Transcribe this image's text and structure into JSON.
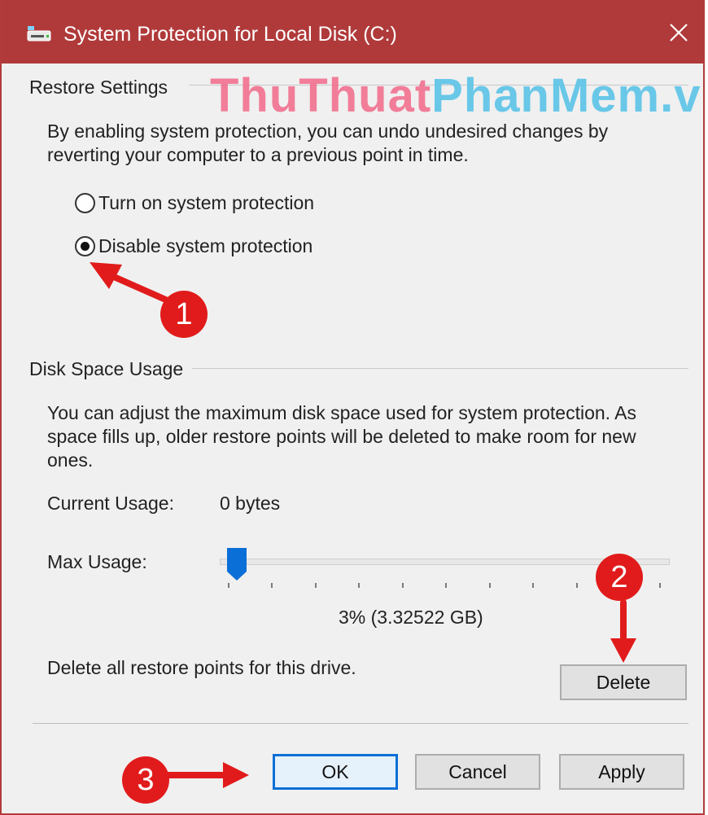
{
  "window": {
    "title": "System Protection for Local Disk (C:)"
  },
  "watermark": {
    "part1": "ThuThuat",
    "part2": "PhanMem.vn"
  },
  "restore_settings": {
    "group_label": "Restore Settings",
    "description_line1": "By enabling system protection, you can undo undesired changes by",
    "description_line2": "reverting your computer to a previous point in time.",
    "options": [
      {
        "label": "Turn on system protection",
        "selected": false
      },
      {
        "label": "Disable system protection",
        "selected": true
      }
    ]
  },
  "disk_space": {
    "group_label": "Disk Space Usage",
    "description_line1": "You can adjust the maximum disk space used for system protection. As",
    "description_line2": "space fills up, older restore points will be deleted to make room for new",
    "description_line3": "ones.",
    "current_usage_label": "Current Usage:",
    "current_usage_value": "0 bytes",
    "max_usage_label": "Max Usage:",
    "max_usage_percent": 3,
    "max_usage_value": "3% (3.32522 GB)",
    "delete_text": "Delete all restore points for this drive.",
    "delete_button": "Delete"
  },
  "footer": {
    "ok": "OK",
    "cancel": "Cancel",
    "apply": "Apply"
  },
  "annotations": {
    "step1": "1",
    "step2": "2",
    "step3": "3"
  },
  "colors": {
    "titlebar": "#b03a3a",
    "annotation_red": "#e11b1b",
    "slider_thumb": "#0a6fd6"
  }
}
